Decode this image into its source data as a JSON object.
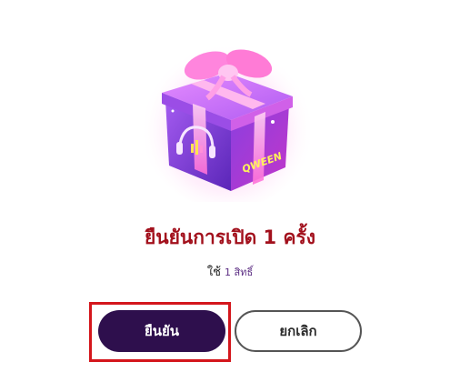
{
  "dialog": {
    "title": "ยืนยันการเปิด 1 ครั้ง",
    "usage_label": "ใช้",
    "usage_count": "1 สิทธิ์",
    "gift_icon": "gift-box-icon",
    "gift_box_text": "QWEEN",
    "confirm_label": "ยืนยัน",
    "cancel_label": "ยกเลิก"
  },
  "colors": {
    "title": "#a2101c",
    "confirm_bg": "#2e0f4d",
    "highlight": "#d4161c",
    "gift_purple": "#7a3fd6",
    "gift_pink": "#ff6fd8"
  }
}
